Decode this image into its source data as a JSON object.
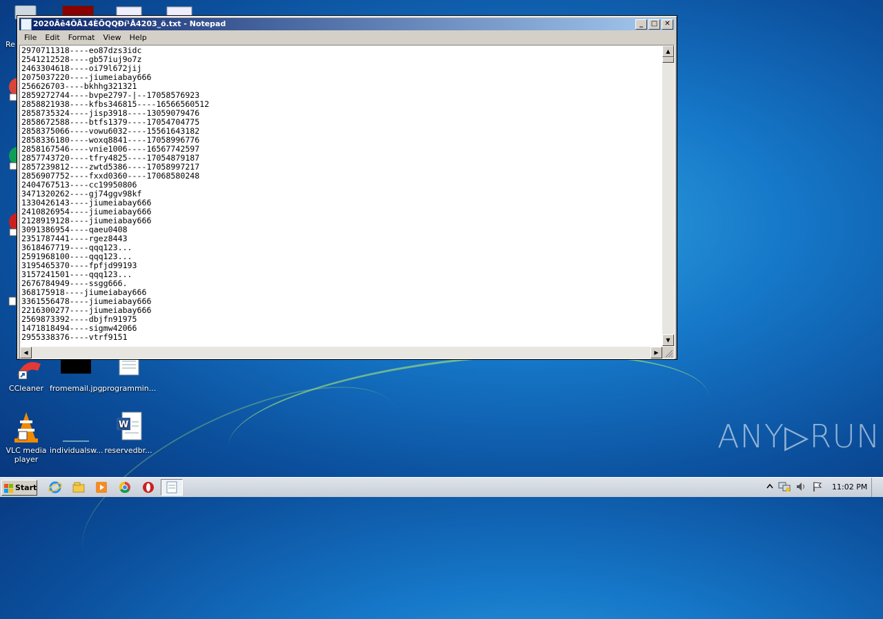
{
  "desktop": {
    "icons": [
      {
        "label": "CCleaner"
      },
      {
        "label": "fromemail.jpg"
      },
      {
        "label": "programmin..."
      },
      {
        "label": "VLC media player"
      },
      {
        "label": "individualsw..."
      },
      {
        "label": "reservedbr..."
      }
    ],
    "partial_label_top": "Re"
  },
  "window": {
    "title": "2020Äê4ÔÂ14ÈÕQQÐí¹Å4203_ö.txt - Notepad",
    "menu": [
      "File",
      "Edit",
      "Format",
      "View",
      "Help"
    ],
    "content": [
      "2970711318----eo87dzs3idc",
      "2541212528----gb57iuj9o7z",
      "2463304618----oi79l672jij",
      "2075037220----jiumeiabay666",
      "256626703----bkhhg321321",
      "2859272744----bvpe2797-|--17058576923",
      "2858821938----kfbs346815----16566560512",
      "2858735324----jisp3918----13059079476",
      "2858672588----btfs1379----17054704775",
      "2858375066----vowu6032----15561643182",
      "2858336180----woxq8841----17058996776",
      "2858167546----vnie1006----16567742597",
      "2857743720----tfry4825----17054879187",
      "2857239812----zwtd5386----17058997217",
      "2856907752----fxxd0360----17068580248",
      "2404767513----cc19950806",
      "3471320262----gj74ggv98kf",
      "1330426143----jiumeiabay666",
      "2410826954----jiumeiabay666",
      "2128919128----jiumeiabay666",
      "3091386954----qaeu0408",
      "2351787441----rgez8443",
      "3618467719----qqq123...",
      "2591968100----qqq123...",
      "3195465370----fpfjd99193",
      "3157241501----qqq123...",
      "2676784949----ssgg666.",
      "368175918----jiumeiabay666",
      "3361556478----jiumeiabay666",
      "2216300277----jiumeiabay666",
      "2569873392----dbjfn91975",
      "1471818494----sigmw42066",
      "2955338376----vtrf9151"
    ]
  },
  "taskbar": {
    "start_label": "Start",
    "clock": "11:02 PM"
  },
  "watermark": "ANY▷RUN"
}
